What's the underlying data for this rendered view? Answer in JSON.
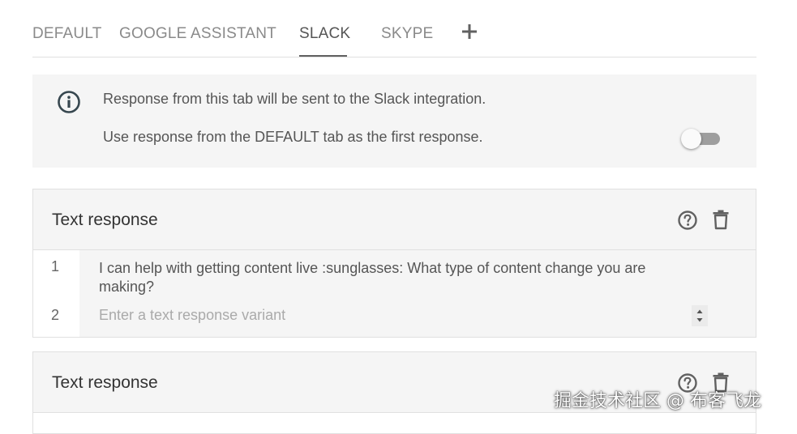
{
  "tabs": [
    {
      "label": "DEFAULT"
    },
    {
      "label": "GOOGLE ASSISTANT"
    },
    {
      "label": "SLACK"
    },
    {
      "label": "SKYPE"
    }
  ],
  "active_tab": "SLACK",
  "add_tab_icon": "plus-icon",
  "info": {
    "icon": "info-icon",
    "message": "Response from this tab will be sent to the Slack integration.",
    "toggle_label": "Use response from the DEFAULT tab as the first response.",
    "toggle_on": false
  },
  "cards": [
    {
      "title": "Text response",
      "rows": [
        {
          "num": "1",
          "text": "I can help with getting content live :sunglasses: What type of content change you are making?"
        },
        {
          "num": "2",
          "placeholder": "Enter a text response variant"
        }
      ]
    },
    {
      "title": "Text response"
    }
  ],
  "watermark": "掘金技术社区 @ 布客飞龙",
  "colors": {
    "icon": "#616161",
    "panel": "#f5f5f5",
    "border": "#e0e0e0"
  }
}
